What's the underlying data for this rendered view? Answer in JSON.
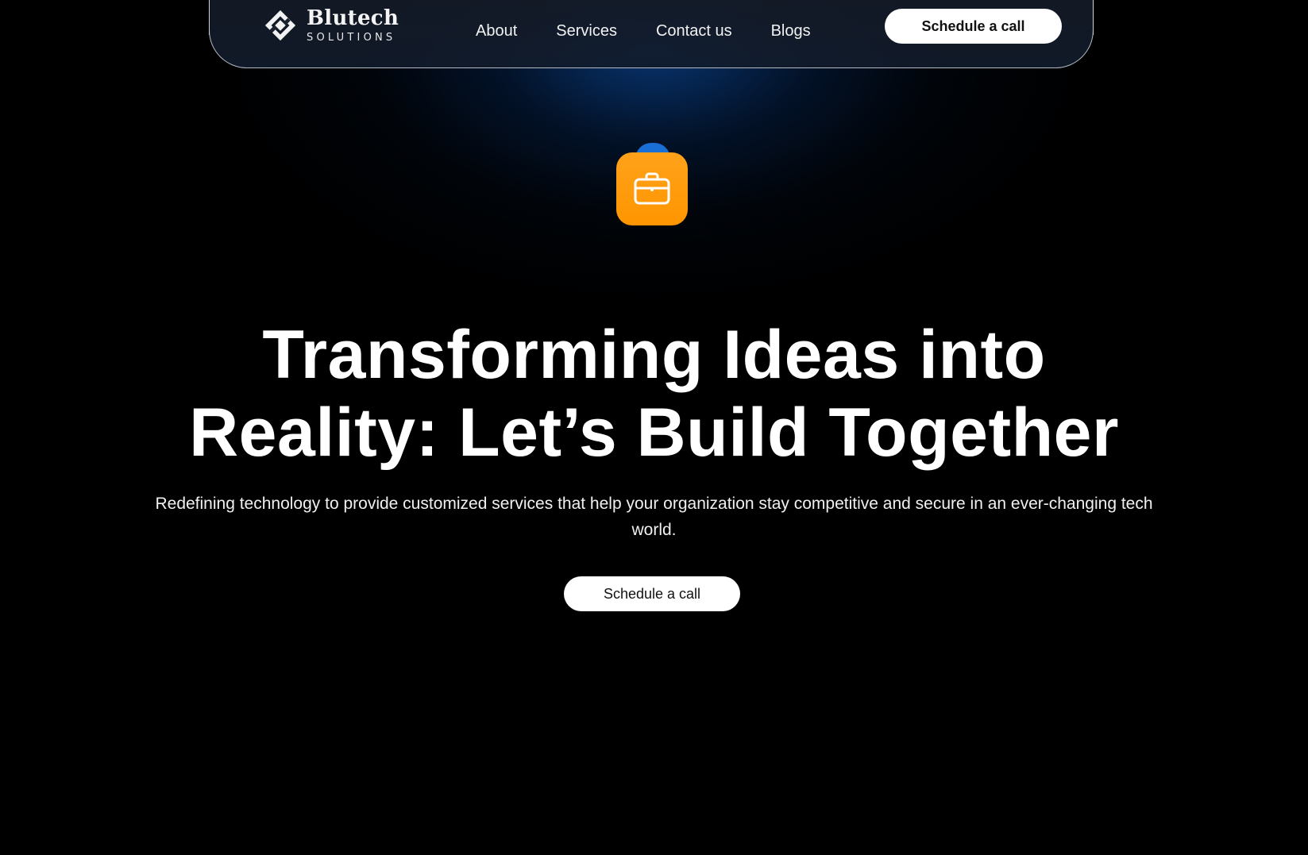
{
  "brand": {
    "name": "Blutech",
    "tagline": "SOLUTIONS",
    "logo_icon": "diamond-logo-icon"
  },
  "nav": {
    "links": [
      {
        "label": "About"
      },
      {
        "label": "Services"
      },
      {
        "label": "Contact us"
      },
      {
        "label": "Blogs"
      }
    ],
    "cta_label": "Schedule a call"
  },
  "hero": {
    "icon": "briefcase-icon",
    "icon_color": "#ff9a0a",
    "icon_accent_color": "#1a6fd6",
    "title_line1": "Transforming Ideas into",
    "title_line2": "Reality: Let’s Build Together",
    "subtitle": "Redefining technology to provide customized services that help your organization stay competitive and secure in an ever-changing tech world.",
    "cta_label": "Schedule a call"
  },
  "colors": {
    "background": "#000000",
    "glow": "#0a4696",
    "button_bg": "#ffffff",
    "button_text": "#111111"
  }
}
